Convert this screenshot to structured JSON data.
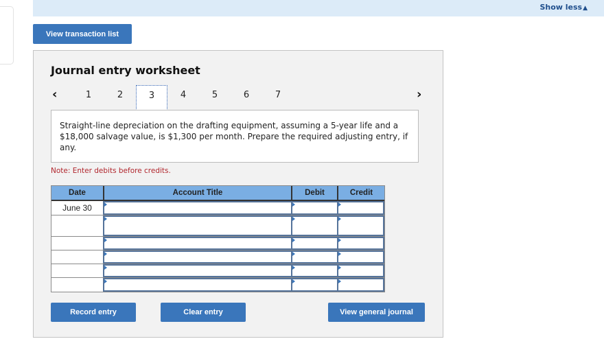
{
  "header": {
    "show_less_label": "Show less",
    "show_less_icon": "▲"
  },
  "view_transaction_list_label": "View transaction list",
  "worksheet": {
    "title": "Journal entry worksheet",
    "pager": {
      "prev_icon": "‹",
      "next_icon": "›",
      "pages": [
        "1",
        "2",
        "3",
        "4",
        "5",
        "6",
        "7"
      ],
      "active_page": "3"
    },
    "question_text": "Straight-line depreciation on the drafting equipment, assuming a 5-year life and a $18,000 salvage value, is $1,300 per month. Prepare the required adjusting entry, if any.",
    "note": "Note: Enter debits before credits.",
    "table": {
      "headers": {
        "date": "Date",
        "account": "Account Title",
        "debit": "Debit",
        "credit": "Credit"
      },
      "rows": [
        {
          "date": "June 30",
          "account": "",
          "debit": "",
          "credit": ""
        },
        {
          "date": "",
          "account": "",
          "debit": "",
          "credit": ""
        },
        {
          "date": "",
          "account": "",
          "debit": "",
          "credit": ""
        },
        {
          "date": "",
          "account": "",
          "debit": "",
          "credit": ""
        },
        {
          "date": "",
          "account": "",
          "debit": "",
          "credit": ""
        },
        {
          "date": "",
          "account": "",
          "debit": "",
          "credit": ""
        }
      ]
    },
    "buttons": {
      "record_entry": "Record entry",
      "clear_entry": "Clear entry",
      "view_general_journal": "View general journal"
    }
  },
  "colors": {
    "button_blue": "#3a76bb",
    "header_blue": "#7aaee3",
    "top_bar": "#dcebf8",
    "note_red": "#b1262d"
  }
}
